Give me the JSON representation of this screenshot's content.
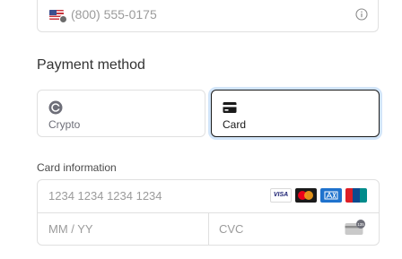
{
  "phone": {
    "placeholder": "(800) 555-0175",
    "country_icon": "us-flag-icon",
    "info_icon": "info-icon"
  },
  "payment_method": {
    "title": "Payment method",
    "options": [
      {
        "label": "Crypto",
        "icon": "crypto-icon",
        "selected": false
      },
      {
        "label": "Card",
        "icon": "card-icon",
        "selected": true
      }
    ]
  },
  "card_info": {
    "label": "Card information",
    "number_placeholder": "1234 1234 1234 1234",
    "expiry_placeholder": "MM / YY",
    "cvc_placeholder": "CVC",
    "brands": [
      {
        "name": "visa-icon",
        "text": "VISA"
      },
      {
        "name": "mastercard-icon"
      },
      {
        "name": "amex-icon"
      },
      {
        "name": "unionpay-icon"
      }
    ],
    "cvc_icon_badge": "135"
  },
  "colors": {
    "accent_focus": "#0570de",
    "border": "#e0e0e0",
    "placeholder": "#9b9b9b"
  }
}
